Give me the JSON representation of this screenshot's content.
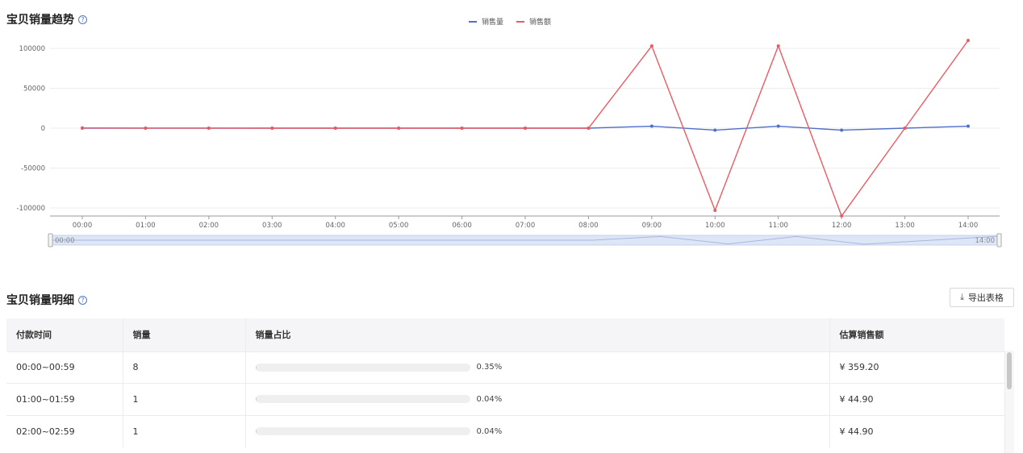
{
  "trend_section": {
    "title": "宝贝销量趋势",
    "help_icon": "question-circle-icon",
    "legend": [
      {
        "label": "销售量",
        "color": "#4f6fc9"
      },
      {
        "label": "销售额",
        "color": "#ec5a63"
      }
    ],
    "zoom_slider": {
      "start_label": "00:00",
      "end_label": "14:00"
    }
  },
  "chart_data": {
    "type": "line",
    "title": "宝贝销量趋势",
    "xlabel": "",
    "ylabel": "",
    "x": [
      "00:00",
      "01:00",
      "02:00",
      "03:00",
      "04:00",
      "05:00",
      "06:00",
      "07:00",
      "08:00",
      "09:00",
      "10:00",
      "11:00",
      "12:00",
      "13:00",
      "14:00"
    ],
    "y_ticks": [
      100000,
      50000,
      0,
      -50000,
      -100000
    ],
    "ylim": [
      -100000,
      100000
    ],
    "grid": true,
    "legend_position": "top-center",
    "series": [
      {
        "name": "销售量",
        "color": "#4f6fc9",
        "values": [
          8,
          1,
          1,
          0,
          0,
          0,
          0,
          0,
          0,
          2500,
          -2500,
          2500,
          -2500,
          0,
          2500
        ]
      },
      {
        "name": "销售额",
        "color": "#ec5a63",
        "values": [
          359.2,
          44.9,
          44.9,
          0,
          0,
          0,
          0,
          0,
          0,
          103000,
          -103000,
          103000,
          -110000,
          0,
          110000
        ]
      }
    ]
  },
  "detail_section": {
    "title": "宝贝销量明细",
    "help_icon": "question-circle-icon",
    "export_button": {
      "icon": "download-icon",
      "label": "导出表格"
    },
    "columns": [
      "付款时间",
      "销量",
      "销量占比",
      "估算销售额"
    ],
    "rows": [
      {
        "time": "00:00~00:59",
        "qty": "8",
        "share": 0.35,
        "share_label": "0.35%",
        "amount": "¥ 359.20"
      },
      {
        "time": "01:00~01:59",
        "qty": "1",
        "share": 0.04,
        "share_label": "0.04%",
        "amount": "¥ 44.90"
      },
      {
        "time": "02:00~02:59",
        "qty": "1",
        "share": 0.04,
        "share_label": "0.04%",
        "amount": "¥ 44.90"
      }
    ]
  }
}
